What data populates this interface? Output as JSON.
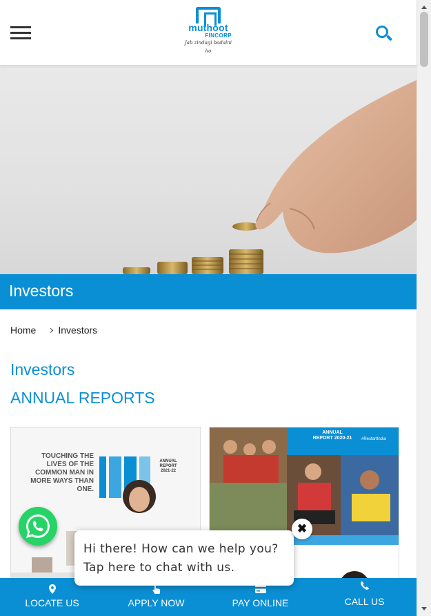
{
  "header": {
    "brand_name": "muthoot",
    "brand_sub": "FINCORP",
    "tagline": "Jab zindagi badalni ho"
  },
  "banner": {
    "title": "Investors"
  },
  "breadcrumb": {
    "home": "Home",
    "current": "Investors"
  },
  "main": {
    "title": "Investors",
    "subtitle": "ANNUAL REPORTS",
    "reports": [
      {
        "cover_text": "TOUCHING THE LIVES OF THE COMMON MAN IN MORE WAYS THAN ONE.",
        "cover_tag": "ANNUAL REPORT 2021-22"
      },
      {
        "cover_tag": "ANNUAL REPORT 2020-21",
        "hashtag": "#RestartIndia"
      }
    ]
  },
  "chat": {
    "message": "Hi there! How can we help you? Tap here to chat with us.",
    "close_glyph": "✖"
  },
  "bottom_nav": [
    {
      "label": "LOCATE US",
      "icon": "map-pin-icon"
    },
    {
      "label": "APPLY NOW",
      "icon": "pointer-hand-icon"
    },
    {
      "label": "PAY ONLINE",
      "icon": "credit-card-icon"
    },
    {
      "label": "CALL US",
      "icon": "phone-icon"
    }
  ],
  "colors": {
    "brand_blue": "#0b8fd4",
    "whatsapp_green": "#25d366"
  }
}
